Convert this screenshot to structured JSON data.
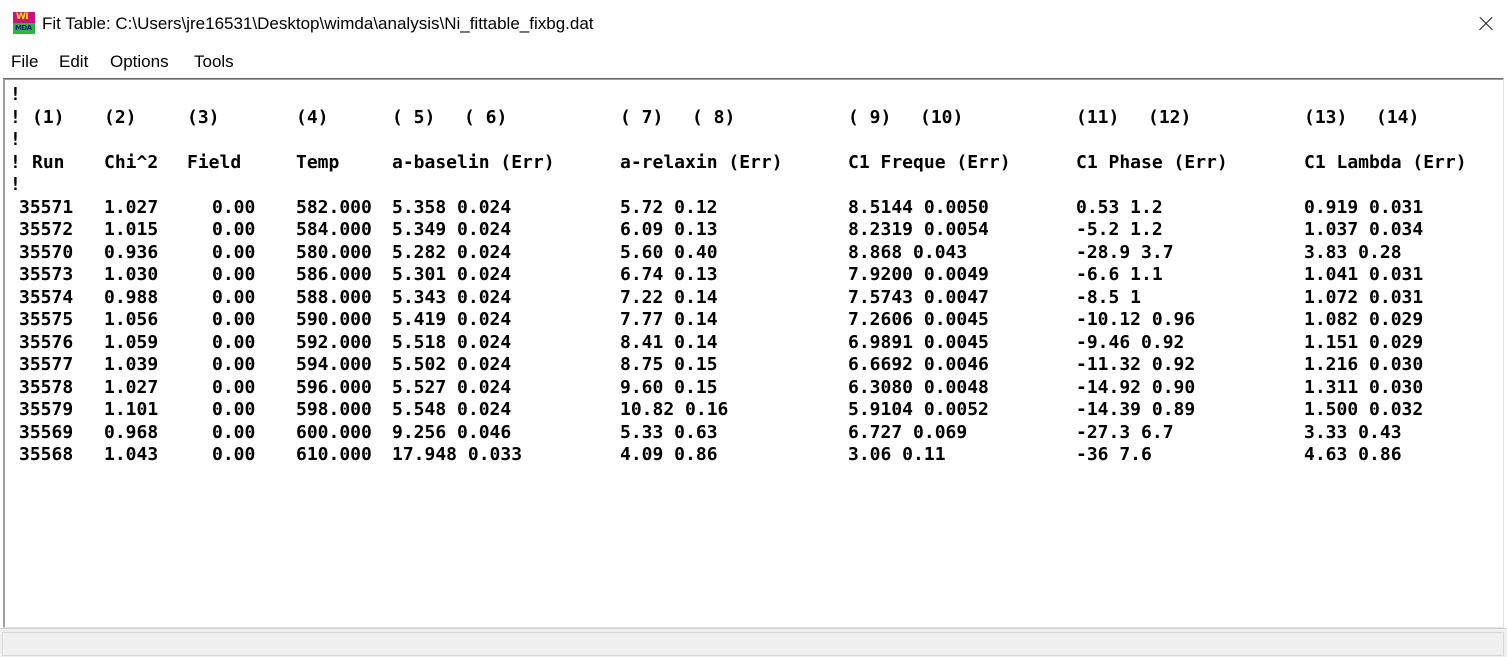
{
  "window": {
    "title": "Fit Table: C:\\Users\\jre16531\\Desktop\\wimda\\analysis\\Ni_fittable_fixbg.dat",
    "icon": "wimda-app-icon",
    "close_icon": "close-icon"
  },
  "menu": {
    "file": "File",
    "edit": "Edit",
    "options": "Options",
    "tools": "Tools"
  },
  "table": {
    "comment_char": "!",
    "column_numbers": [
      "(1)",
      "(2)",
      "(3)",
      "(4)",
      "( 5)",
      "( 6)",
      "( 7)",
      "( 8)",
      "( 9)",
      "(10)",
      "(11)",
      "(12)",
      "(13)",
      "(14)"
    ],
    "headers": [
      "Run",
      "Chi^2",
      "Field",
      "Temp",
      "a-baselin (Err)",
      "a-relaxin (Err)",
      "C1 Freque (Err)",
      "C1 Phase (Err)",
      "C1 Lambda (Err)"
    ],
    "rows": [
      [
        "35571",
        "1.027",
        "0.00",
        "582.000",
        "5.358 0.024",
        "5.72 0.12",
        "8.5144 0.0050",
        "0.53 1.2",
        "0.919 0.031"
      ],
      [
        "35572",
        "1.015",
        "0.00",
        "584.000",
        "5.349 0.024",
        "6.09 0.13",
        "8.2319 0.0054",
        "-5.2 1.2",
        "1.037 0.034"
      ],
      [
        "35570",
        "0.936",
        "0.00",
        "580.000",
        "5.282 0.024",
        "5.60 0.40",
        "8.868 0.043",
        "-28.9 3.7",
        "3.83 0.28"
      ],
      [
        "35573",
        "1.030",
        "0.00",
        "586.000",
        "5.301 0.024",
        "6.74 0.13",
        "7.9200 0.0049",
        "-6.6 1.1",
        "1.041 0.031"
      ],
      [
        "35574",
        "0.988",
        "0.00",
        "588.000",
        "5.343 0.024",
        "7.22 0.14",
        "7.5743 0.0047",
        "-8.5 1",
        "1.072 0.031"
      ],
      [
        "35575",
        "1.056",
        "0.00",
        "590.000",
        "5.419 0.024",
        "7.77 0.14",
        "7.2606 0.0045",
        "-10.12 0.96",
        "1.082 0.029"
      ],
      [
        "35576",
        "1.059",
        "0.00",
        "592.000",
        "5.518 0.024",
        "8.41 0.14",
        "6.9891 0.0045",
        "-9.46 0.92",
        "1.151 0.029"
      ],
      [
        "35577",
        "1.039",
        "0.00",
        "594.000",
        "5.502 0.024",
        "8.75 0.15",
        "6.6692 0.0046",
        "-11.32 0.92",
        "1.216 0.030"
      ],
      [
        "35578",
        "1.027",
        "0.00",
        "596.000",
        "5.527 0.024",
        "9.60 0.15",
        "6.3080 0.0048",
        "-14.92 0.90",
        "1.311 0.030"
      ],
      [
        "35579",
        "1.101",
        "0.00",
        "598.000",
        "5.548 0.024",
        "10.82 0.16",
        "5.9104 0.0052",
        "-14.39 0.89",
        "1.500 0.032"
      ],
      [
        "35569",
        "0.968",
        "0.00",
        "600.000",
        "9.256 0.046",
        "5.33 0.63",
        "6.727 0.069",
        "-27.3 6.7",
        "3.33 0.43"
      ],
      [
        "35568",
        "1.043",
        "0.00",
        "610.000",
        "17.948 0.033",
        "4.09 0.86",
        "3.06 0.11",
        "-36 7.6",
        "4.63 0.86"
      ]
    ]
  }
}
